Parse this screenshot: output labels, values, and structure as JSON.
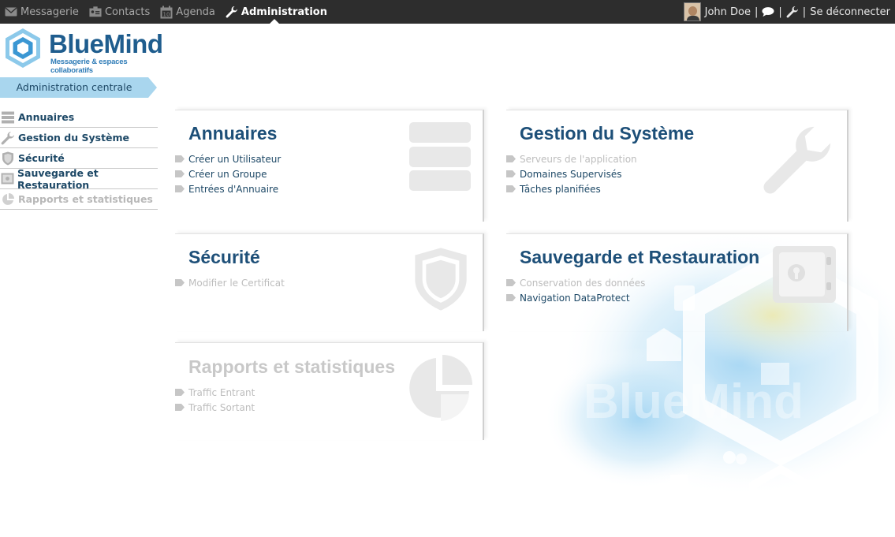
{
  "topbar": {
    "nav": [
      {
        "label": "Messagerie",
        "icon": "mail-icon",
        "active": false
      },
      {
        "label": "Contacts",
        "icon": "contacts-icon",
        "active": false
      },
      {
        "label": "Agenda",
        "icon": "calendar-icon",
        "active": false
      },
      {
        "label": "Administration",
        "icon": "wrench-icon",
        "active": true
      }
    ],
    "user_name": "John Doe",
    "separator": "|",
    "logout_label": "Se déconnecter"
  },
  "logo": {
    "name": "BlueMind",
    "tagline": "Messagerie & espaces collaboratifs"
  },
  "banner": {
    "label": "Administration centrale"
  },
  "sidebar": {
    "items": [
      {
        "label": "Annuaires",
        "icon": "directory-icon",
        "enabled": true
      },
      {
        "label": "Gestion du Système",
        "icon": "wrench-icon",
        "enabled": true
      },
      {
        "label": "Sécurité",
        "icon": "shield-icon",
        "enabled": true
      },
      {
        "label": "Sauvegarde et Restauration",
        "icon": "safe-icon",
        "enabled": true
      },
      {
        "label": "Rapports et statistiques",
        "icon": "pie-chart-icon",
        "enabled": false
      }
    ]
  },
  "cards": {
    "annuaires": {
      "title": "Annuaires",
      "icon": "directory-icon",
      "links": [
        {
          "label": "Créer un Utilisateur",
          "enabled": true
        },
        {
          "label": "Créer un Groupe",
          "enabled": true
        },
        {
          "label": "Entrées d'Annuaire",
          "enabled": true
        }
      ]
    },
    "systeme": {
      "title": "Gestion du Système",
      "icon": "wrench-icon",
      "links": [
        {
          "label": "Serveurs de l'application",
          "enabled": false
        },
        {
          "label": "Domaines Supervisés",
          "enabled": true
        },
        {
          "label": "Tâches planifiées",
          "enabled": true
        }
      ]
    },
    "securite": {
      "title": "Sécurité",
      "icon": "shield-icon",
      "links": [
        {
          "label": "Modifier le Certificat",
          "enabled": false
        }
      ]
    },
    "sauvegarde": {
      "title": "Sauvegarde et Restauration",
      "icon": "safe-icon",
      "links": [
        {
          "label": "Conservation des données",
          "enabled": false
        },
        {
          "label": "Navigation DataProtect",
          "enabled": true
        }
      ]
    },
    "rapports": {
      "title": "Rapports et statistiques",
      "icon": "pie-chart-icon",
      "enabled": false,
      "links": [
        {
          "label": "Traffic Entrant",
          "enabled": false
        },
        {
          "label": "Traffic Sortant",
          "enabled": false
        }
      ]
    }
  },
  "colors": {
    "topbar_bg": "#2d2d2d",
    "brand_blue": "#1d4f78",
    "banner_bg": "#a9d6ee",
    "disabled_text": "#bdbdbd"
  }
}
